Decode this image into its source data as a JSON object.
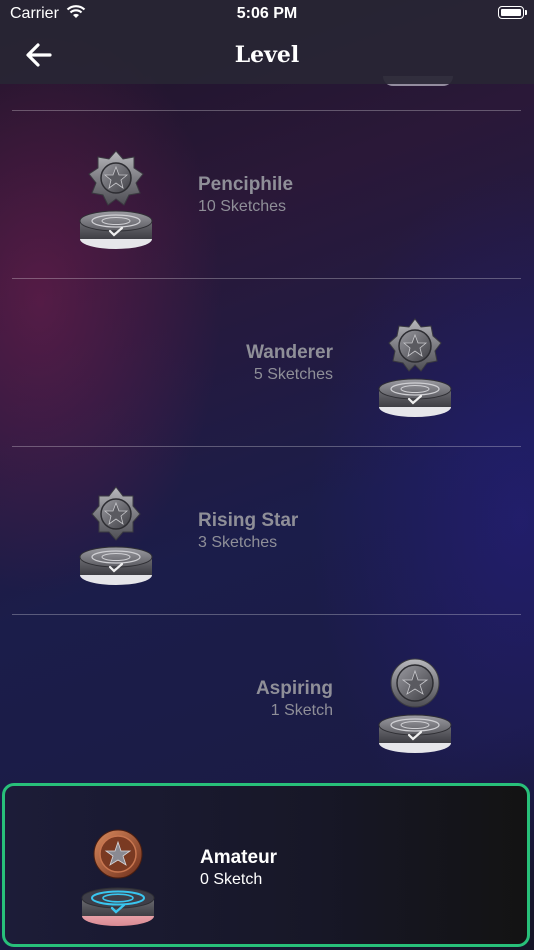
{
  "status_bar": {
    "carrier": "Carrier",
    "time": "5:06 PM"
  },
  "nav": {
    "title": "Level",
    "back_icon": "arrow-left-icon"
  },
  "levels": [
    {
      "name": "Penciphile",
      "sketches": "10 Sketches",
      "medal": "star-medal-badge",
      "locked": true
    },
    {
      "name": "Wanderer",
      "sketches": "5 Sketches",
      "medal": "star-medal-badge",
      "locked": true
    },
    {
      "name": "Rising Star",
      "sketches": "3 Sketches",
      "medal": "star-medal-badge",
      "locked": true
    },
    {
      "name": "Aspiring",
      "sketches": "1 Sketch",
      "medal": "star-medal-round",
      "locked": true
    },
    {
      "name": "Amateur",
      "sketches": "0 Sketch",
      "medal": "bronze-star-medal",
      "locked": false,
      "selected": true
    }
  ],
  "colors": {
    "selected_border": "#28c07a",
    "locked_text": "#8f8f98",
    "active_text": "#ffffff"
  }
}
